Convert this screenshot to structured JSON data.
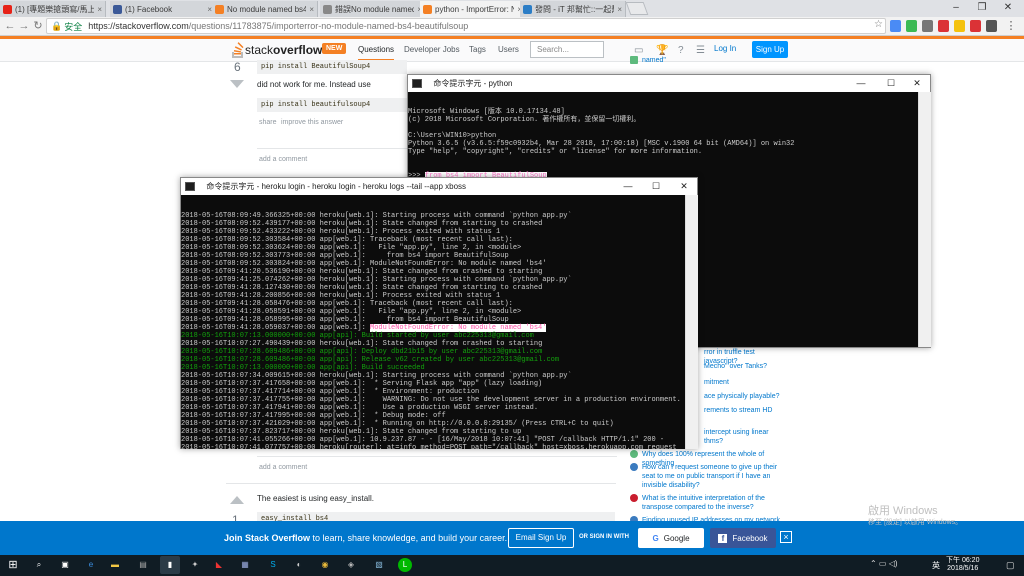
{
  "browser": {
    "tabs": [
      {
        "label": "(1) [專題樂搶頭寫/馬上]",
        "color": "#e62117",
        "icon": "youtube-icon"
      },
      {
        "label": "(1) Facebook",
        "color": "#3b5998",
        "icon": "facebook-icon"
      },
      {
        "label": "No module named bs4",
        "color": "#f48024",
        "icon": "stackoverflow-icon"
      },
      {
        "label": "錯誤No module named bs4",
        "color": "#888888",
        "icon": "page-icon"
      },
      {
        "label": "python - ImportError: N",
        "color": "#f48024",
        "icon": "stackoverflow-icon"
      },
      {
        "label": "發問 - iT 邦幫忙::一起幫忙",
        "color": "#2b7dc6",
        "icon": "ithelp-icon"
      }
    ],
    "active_tab": 4,
    "secure_label": "安全",
    "url_host": "https://stackoverflow.com",
    "url_path": "/questions/11783875/importerror-no-module-named-bs4-beautifulsoup",
    "window_controls": [
      "–",
      "❐",
      "✕"
    ]
  },
  "so_header": {
    "logo_text_light": "stack",
    "logo_text_bold": "overflow",
    "new_badge": "NEW",
    "nav": [
      "Questions",
      "Developer Jobs",
      "Tags",
      "Users"
    ],
    "search_placeholder": "Search...",
    "login": "Log In",
    "signup": "Sign Up"
  },
  "answer1": {
    "vote_count": "6",
    "command": "pip install BeautifulSoup4",
    "text": "did not work for me. Instead use",
    "code": "pip install beautifulsoup4",
    "share": "share",
    "improve": "improve this answer",
    "add_comment": "add a comment"
  },
  "answer2": {
    "add_comment": "add a comment",
    "text": "The easiest is using easy_install.",
    "code": "easy_install bs4",
    "vote_count": "1"
  },
  "sidebar": {
    "top_item": "named\"",
    "items": [
      {
        "text": "rror in truffle test javascript?",
        "color": "#5eba7d"
      },
      {
        "text": "Mecho\" over Tanks?",
        "color": "#5eba7d"
      },
      {
        "text": "mitment",
        "color": "#5eba7d"
      },
      {
        "text": "ace physically playable?",
        "color": "#5eba7d"
      },
      {
        "text": "rements to stream HD",
        "color": "#5eba7d"
      },
      {
        "text": "intercept using linear",
        "color": "#5eba7d"
      },
      {
        "text": "thms?",
        "color": "#5eba7d"
      },
      {
        "text": "Why does 100% represent the whole of something",
        "color": "#5eba7d"
      },
      {
        "text": "How can I request someone to give up their seat to me on public transport if I have an invisible disability?",
        "color": "#3b7bbf"
      },
      {
        "text": "What is the intuitive interpretation of the transpose compared to the inverse?",
        "color": "#c91d2e"
      },
      {
        "text": "Finding unused IP addresses on my network in",
        "color": "#3b7bbf"
      }
    ]
  },
  "python_console": {
    "title": "ﾠ命令提示字元 - python",
    "lines": [
      {
        "t": "Microsoft Windows [版本 10.0.17134.48]",
        "c": "#cccccc"
      },
      {
        "t": "(c) 2018 Microsoft Corporation. 著作權所有，並保留一切權利。",
        "c": "#cccccc"
      },
      {
        "t": "",
        "c": "#cccccc"
      },
      {
        "t": "C:\\Users\\WIN10>python",
        "c": "#cccccc"
      },
      {
        "t": "Python 3.6.5 (v3.6.5:f59c0932b4, Mar 28 2018, 17:00:18) [MSC v.1900 64 bit (AMD64)] on win32",
        "c": "#cccccc"
      },
      {
        "t": "Type \"help\", \"copyright\", \"credits\" or \"license\" for more information.",
        "c": "#cccccc"
      }
    ],
    "highlight_prompt": ">>> ",
    "highlight_text": "from bs4 import BeautifulSoup",
    "last_prompt": ">>>"
  },
  "heroku_console": {
    "title": "ﾠ命令提示字元 - heroku login - heroku login - heroku logs --tail --app xboss",
    "lines": [
      {
        "p": "2018-05-16T08:09:49.366325+00:00 heroku[web.1]: ",
        "m": "Starting process with command `python app.py`",
        "c": "#cccccc"
      },
      {
        "p": "2018-05-16T08:09:52.439177+00:00 heroku[web.1]: ",
        "m": "State changed from starting to crashed",
        "c": "#cccccc"
      },
      {
        "p": "2018-05-16T08:09:52.433222+00:00 heroku[web.1]: ",
        "m": "Process exited with status 1",
        "c": "#cccccc"
      },
      {
        "p": "2018-05-16T08:09:52.303584+00:00 app[web.1]: ",
        "m": "Traceback (most recent call last):",
        "c": "#cccccc"
      },
      {
        "p": "2018-05-16T08:09:52.303624+00:00 app[web.1]: ",
        "m": "  File \"app.py\", line 2, in <module>",
        "c": "#cccccc"
      },
      {
        "p": "2018-05-16T08:09:52.303773+00:00 app[web.1]: ",
        "m": "    from bs4 import BeautifulSoup",
        "c": "#cccccc"
      },
      {
        "p": "2018-05-16T08:09:52.303824+00:00 app[web.1]: ",
        "m": "ModuleNotFoundError: No module named 'bs4'",
        "c": "#cccccc"
      },
      {
        "p": "2018-05-16T09:41:20.536190+00:00 heroku[web.1]: ",
        "m": "State changed from crashed to starting",
        "c": "#cccccc"
      },
      {
        "p": "2018-05-16T09:41:25.074262+00:00 heroku[web.1]: ",
        "m": "Starting process with command `python app.py`",
        "c": "#cccccc"
      },
      {
        "p": "2018-05-16T09:41:28.127430+00:00 heroku[web.1]: ",
        "m": "State changed from starting to crashed",
        "c": "#cccccc"
      },
      {
        "p": "2018-05-16T09:41:28.200856+00:00 heroku[web.1]: ",
        "m": "Process exited with status 1",
        "c": "#cccccc"
      },
      {
        "p": "2018-05-16T09:41:28.058476+00:00 app[web.1]: ",
        "m": "Traceback (most recent call last):",
        "c": "#cccccc"
      },
      {
        "p": "2018-05-16T09:41:28.058591+00:00 app[web.1]: ",
        "m": "  File \"app.py\", line 2, in <module>",
        "c": "#cccccc"
      },
      {
        "p": "2018-05-16T09:41:28.058995+00:00 app[web.1]: ",
        "m": "    from bs4 import BeautifulSoup",
        "c": "#cccccc"
      },
      {
        "p": "2018-05-16T09:41:28.059037+00:00 app[web.1]: ",
        "m": "ModuleNotFoundError: No module named 'bs4'",
        "c": "#cccccc",
        "hl": true
      },
      {
        "p": "2018-05-16T10:07:13.000000+00:00 app[api]: ",
        "m": "Build started by user abc225313@gmail.com",
        "c": "#13a10e"
      },
      {
        "p": "2018-05-16T10:07:27.490439+00:00 heroku[web.1]: ",
        "m": "State changed from crashed to starting",
        "c": "#cccccc"
      },
      {
        "p": "2018-05-16T10:07:28.609486+00:00 app[api]: ",
        "m": "Deploy dbd21b15 by user abc225313@gmail.com",
        "c": "#13a10e"
      },
      {
        "p": "2018-05-16T10:07:28.609486+00:00 app[api]: ",
        "m": "Release v62 created by user abc225313@gmail.com",
        "c": "#13a10e"
      },
      {
        "p": "2018-05-16T10:07:13.000000+00:00 app[api]: ",
        "m": "Build succeeded",
        "c": "#13a10e"
      },
      {
        "p": "2018-05-16T10:07:34.009615+00:00 heroku[web.1]: ",
        "m": "Starting process with command `python app.py`",
        "c": "#cccccc"
      },
      {
        "p": "2018-05-16T10:07:37.417658+00:00 app[web.1]: ",
        "m": " * Serving Flask app \"app\" (lazy loading)",
        "c": "#cccccc"
      },
      {
        "p": "2018-05-16T10:07:37.417714+00:00 app[web.1]: ",
        "m": " * Environment: production",
        "c": "#cccccc"
      },
      {
        "p": "2018-05-16T10:07:37.417755+00:00 app[web.1]: ",
        "m": "   WARNING: Do not use the development server in a production environment.",
        "c": "#cccccc"
      },
      {
        "p": "2018-05-16T10:07:37.417941+00:00 app[web.1]: ",
        "m": "   Use a production WSGI server instead.",
        "c": "#cccccc"
      },
      {
        "p": "2018-05-16T10:07:37.417995+00:00 app[web.1]: ",
        "m": " * Debug mode: off",
        "c": "#cccccc"
      },
      {
        "p": "2018-05-16T10:07:37.421029+00:00 app[web.1]: ",
        "m": " * Running on http://0.0.0.0:29135/ (Press CTRL+C to quit)",
        "c": "#cccccc"
      },
      {
        "p": "2018-05-16T10:07:37.823717+00:00 heroku[web.1]: ",
        "m": "State changed from starting to up",
        "c": "#cccccc"
      },
      {
        "p": "2018-05-16T10:07:41.055266+00:00 app[web.1]: ",
        "m": "10.9.237.87 - - [16/May/2018 10:07:41] \"POST /callback HTTP/1.1\" 200 -",
        "c": "#cccccc"
      },
      {
        "p": "2018-05-16T10:07:41.077757+00:00 heroku[router]: ",
        "m": "at=info method=POST path=\"/callback\" host=xboss.herokuapp.com request_",
        "c": "#cccccc"
      }
    ]
  },
  "joinbar": {
    "text_bold": "Join Stack Overflow",
    "text_rest": " to learn, share knowledge, and build your career.",
    "email_signup": "Email Sign Up",
    "or_text": "OR SIGN IN WITH",
    "google": "Google",
    "facebook": "Facebook"
  },
  "taskbar": {
    "time": "下午 06:20",
    "date": "2018/5/16",
    "ime": "英"
  },
  "watermark": {
    "line1": "啟用 Windows",
    "line2": "移至 [設定] 以啟用 Windows。"
  }
}
